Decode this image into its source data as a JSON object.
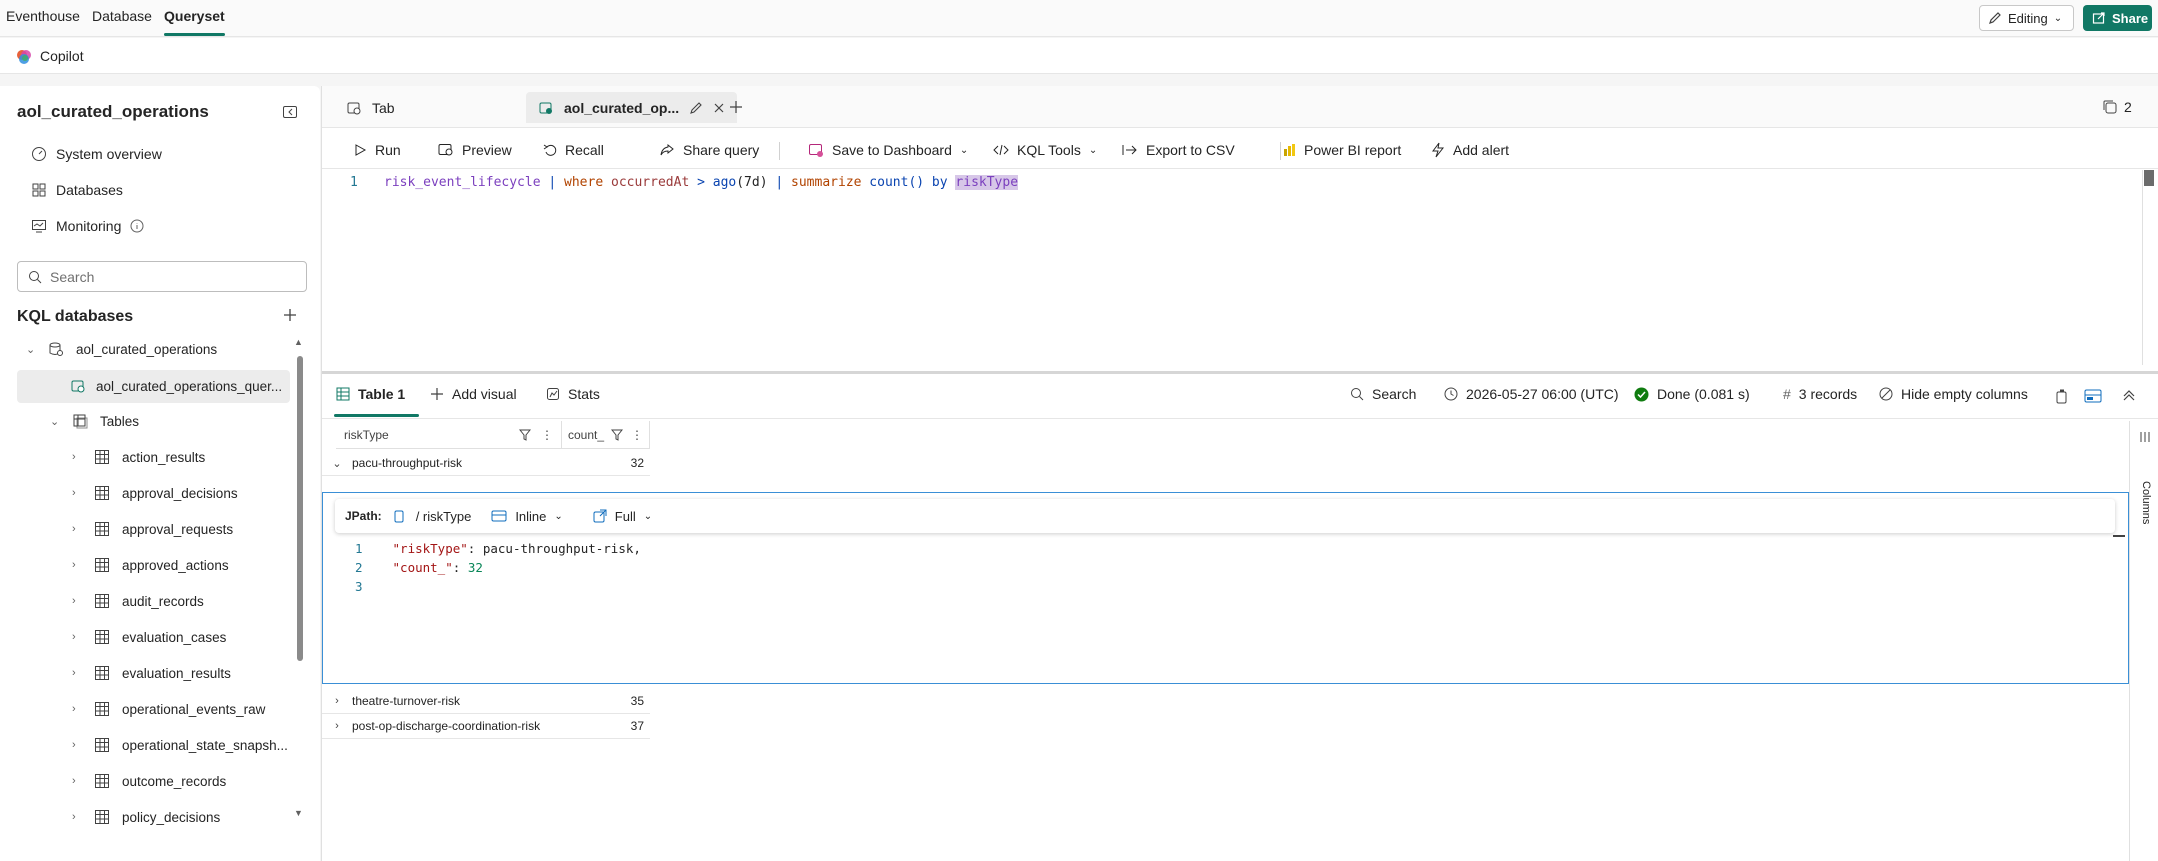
{
  "nav": {
    "tabs": [
      "Eventhouse",
      "Database",
      "Queryset"
    ],
    "active": "Queryset",
    "editing_label": "Editing",
    "share_label": "Share"
  },
  "copilot": {
    "label": "Copilot"
  },
  "sidebar": {
    "title": "aol_curated_operations",
    "nav": [
      "System overview",
      "Databases",
      "Monitoring"
    ],
    "search_placeholder": "Search",
    "kql_title": "KQL databases",
    "db_name": "aol_curated_operations",
    "queryset_name": "aol_curated_operations_quer...",
    "tables_label": "Tables",
    "tables": [
      "action_results",
      "approval_decisions",
      "approval_requests",
      "approved_actions",
      "audit_records",
      "evaluation_cases",
      "evaluation_results",
      "operational_events_raw",
      "operational_state_snapsh...",
      "outcome_records",
      "policy_decisions"
    ]
  },
  "tabs": {
    "tab1": "Tab",
    "tab2": "aol_curated_op...",
    "count": "2"
  },
  "toolbar": {
    "run": "Run",
    "preview": "Preview",
    "recall": "Recall",
    "share_query": "Share query",
    "save_dashboard": "Save to Dashboard",
    "kql_tools": "KQL Tools",
    "export_csv": "Export to CSV",
    "powerbi": "Power BI report",
    "add_alert": "Add alert"
  },
  "editor": {
    "line": "1",
    "tokens": {
      "table": "risk_event_lifecycle",
      "pipe1": " | ",
      "where": "where",
      "field": " occurredAt",
      "gt": " > ",
      "ago": "ago",
      "ago_arg": "(7d)",
      "pipe2": " | ",
      "summarize": "summarize",
      "count": " count()",
      "by": " by ",
      "group": "riskType"
    }
  },
  "results": {
    "tab_table": "Table 1",
    "add_visual": "Add visual",
    "stats": "Stats",
    "search": "Search",
    "timestamp": "2026-05-27 06:00 (UTC)",
    "status": "Done (0.081 s)",
    "records": "3 records",
    "hide_empty": "Hide empty columns",
    "columns_panel": "Columns",
    "headers": [
      "riskType",
      "count_"
    ],
    "rows": [
      {
        "riskType": "pacu-throughput-risk",
        "count_": "32"
      },
      {
        "riskType": "theatre-turnover-risk",
        "count_": "35"
      },
      {
        "riskType": "post-op-discharge-coordination-risk",
        "count_": "37"
      }
    ],
    "jpath_label": "JPath:",
    "jpath_value": "/ riskType",
    "inline": "Inline",
    "full": "Full",
    "json_lines": [
      {
        "n": "1",
        "key": "\"riskType\"",
        "sep": ": ",
        "val": "pacu-throughput-risk,",
        "num": ""
      },
      {
        "n": "2",
        "key": "\"count_\"",
        "sep": ": ",
        "val": "",
        "num": "32"
      },
      {
        "n": "3",
        "key": "",
        "sep": "",
        "val": "",
        "num": ""
      }
    ]
  }
}
